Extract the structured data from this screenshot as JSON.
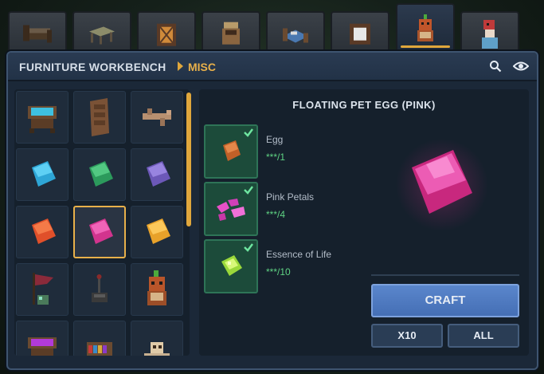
{
  "tabs": [
    {
      "icon": "bed-dark-icon",
      "active": false
    },
    {
      "icon": "table-icon",
      "active": false
    },
    {
      "icon": "lantern-icon",
      "active": false
    },
    {
      "icon": "potted-plant-icon",
      "active": false
    },
    {
      "icon": "bed-blue-icon",
      "active": false
    },
    {
      "icon": "crate-icon",
      "active": false
    },
    {
      "icon": "pet-creature-icon",
      "active": true
    },
    {
      "icon": "gift-creature-icon",
      "active": false
    }
  ],
  "header": {
    "title": "FURNITURE WORKBENCH",
    "crumb": "MISC",
    "search_icon": "search-icon",
    "view_icon": "eye-icon"
  },
  "grid": {
    "items": [
      {
        "icon": "water-planter-icon"
      },
      {
        "icon": "wooden-door-icon"
      },
      {
        "icon": "driftwood-icon"
      },
      {
        "icon": "cyan-egg-icon"
      },
      {
        "icon": "green-egg-icon"
      },
      {
        "icon": "purple-egg-icon"
      },
      {
        "icon": "orange-egg-icon"
      },
      {
        "icon": "pink-egg-icon",
        "selected": true
      },
      {
        "icon": "yellow-egg-icon"
      },
      {
        "icon": "flag-decoration-icon"
      },
      {
        "icon": "lever-icon"
      },
      {
        "icon": "sprout-pet-icon"
      },
      {
        "icon": "purple-planter-icon"
      },
      {
        "icon": "bookshelf-icon"
      },
      {
        "icon": "bone-pile-icon"
      }
    ]
  },
  "detail": {
    "title": "FLOATING PET EGG (PINK)",
    "ingredients": [
      {
        "name": "Egg",
        "count": "***/1",
        "icon": "egg-icon"
      },
      {
        "name": "Pink Petals",
        "count": "***/4",
        "icon": "pink-petals-icon"
      },
      {
        "name": "Essence of Life",
        "count": "***/10",
        "icon": "essence-of-life-icon"
      }
    ],
    "preview_icon": "pink-egg-preview-icon"
  },
  "actions": {
    "craft": "CRAFT",
    "x10": "X10",
    "all": "ALL"
  },
  "colors": {
    "accent": "#e0a73c",
    "panel": "#1b2838",
    "craft_button": "#5a86cc",
    "ingredient_ok": "#5fd383",
    "pink_egg": "#e0449e"
  }
}
